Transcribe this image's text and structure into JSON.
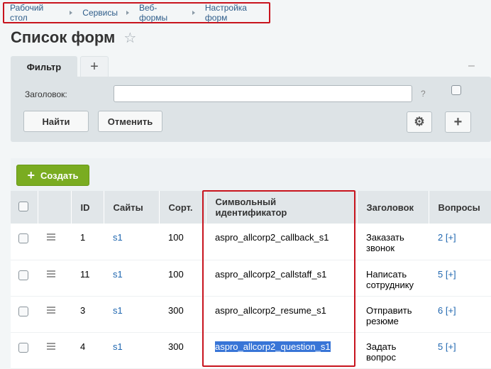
{
  "breadcrumb": [
    "Рабочий стол",
    "Сервисы",
    "Веб-формы",
    "Настройка форм"
  ],
  "page_title": "Список форм",
  "filter": {
    "tab_label": "Фильтр",
    "add_tab_label": "+",
    "minimize_label": "–",
    "heading_label": "Заголовок:",
    "heading_value": "",
    "help_label": "?",
    "find_label": "Найти",
    "cancel_label": "Отменить",
    "plus_label": "+"
  },
  "toolbar": {
    "create_label": "Создать"
  },
  "table": {
    "columns": [
      "ID",
      "Сайты",
      "Сорт.",
      "Символьный идентификатор",
      "Заголовок",
      "Вопросы"
    ],
    "rows": [
      {
        "id": "1",
        "site": "s1",
        "sort": "100",
        "code": "aspro_allcorp2_callback_s1",
        "title": "Заказать звонок",
        "questions": "2 [+]"
      },
      {
        "id": "11",
        "site": "s1",
        "sort": "100",
        "code": "aspro_allcorp2_callstaff_s1",
        "title": "Написать сотруднику",
        "questions": "5 [+]"
      },
      {
        "id": "3",
        "site": "s1",
        "sort": "300",
        "code": "aspro_allcorp2_resume_s1",
        "title": "Отправить резюме",
        "questions": "6 [+]"
      },
      {
        "id": "4",
        "site": "s1",
        "sort": "300",
        "code": "aspro_allcorp2_question_s1",
        "title": "Задать вопрос",
        "questions": "5 [+]"
      }
    ]
  },
  "icons": {
    "star": "star-icon",
    "gear": "gear-icon",
    "menu": "menu-icon"
  },
  "colors": {
    "highlight": "#c8141e",
    "create_button": "#7aac21",
    "link": "#2067b0",
    "selection": "#3875d7"
  }
}
